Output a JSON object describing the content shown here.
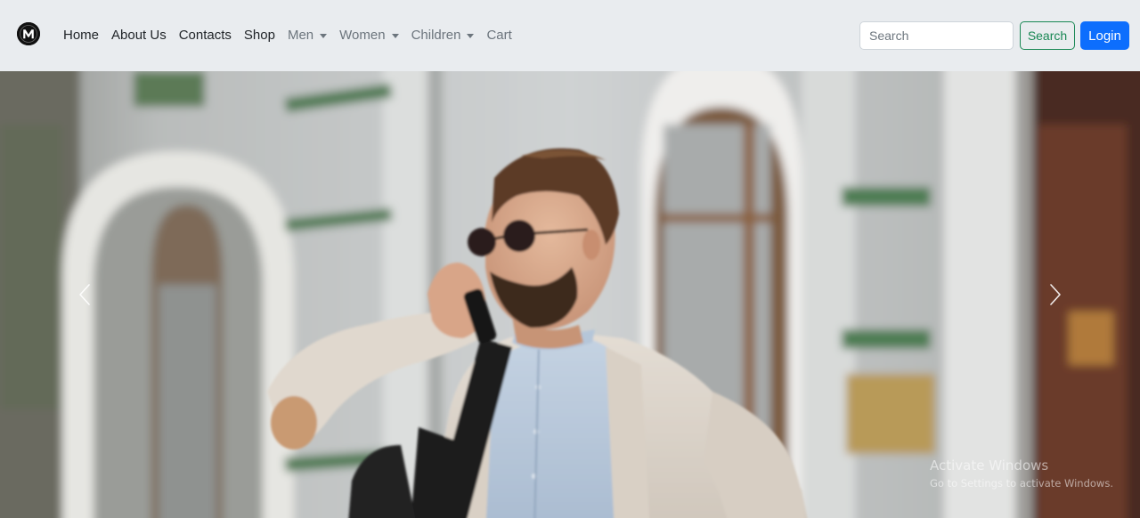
{
  "brand": {
    "logo_icon": "m-circle-logo-icon",
    "logo_letter": "M"
  },
  "nav": {
    "items": [
      {
        "label": "Home",
        "dropdown": false
      },
      {
        "label": "About Us",
        "dropdown": false
      },
      {
        "label": "Contacts",
        "dropdown": false
      },
      {
        "label": "Shop",
        "dropdown": false
      },
      {
        "label": "Men",
        "dropdown": true
      },
      {
        "label": "Women",
        "dropdown": true
      },
      {
        "label": "Children",
        "dropdown": true
      },
      {
        "label": "Cart",
        "dropdown": false
      }
    ]
  },
  "search": {
    "placeholder": "Search",
    "value": "",
    "button_label": "Search"
  },
  "login": {
    "label": "Login"
  },
  "carousel": {
    "prev_icon": "chevron-left-icon",
    "next_icon": "chevron-right-icon",
    "slide_image": "man-in-sunglasses-on-phone-photo"
  },
  "watermark": {
    "title": "Activate Windows",
    "subtitle": "Go to Settings to activate Windows."
  },
  "colors": {
    "navbar_bg": "#e9ecef",
    "nav_text": "#212529",
    "nav_muted": "#6c757d",
    "search_accent": "#198754",
    "login_bg": "#0d6efd"
  }
}
